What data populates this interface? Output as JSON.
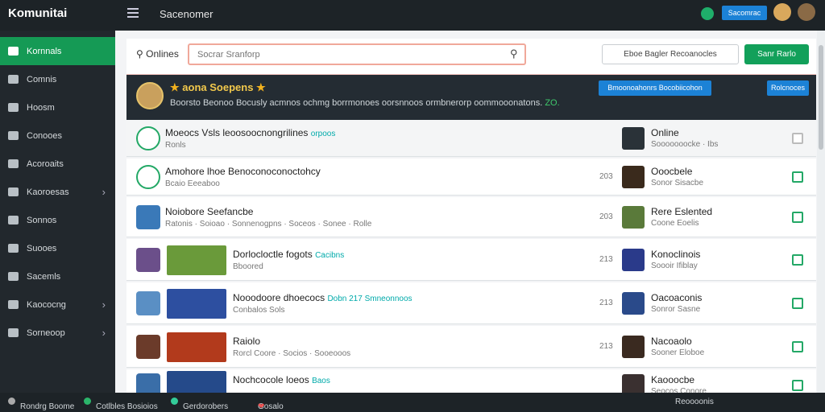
{
  "header": {
    "brand": "Komunitai",
    "title": "Sacenomer",
    "button": "Sacomrac"
  },
  "sidebar": {
    "items": [
      {
        "label": "Kornnals",
        "active": true,
        "chevron": false
      },
      {
        "label": "Comnis",
        "active": false,
        "chevron": false
      },
      {
        "label": "Hoosm",
        "active": false,
        "chevron": false
      },
      {
        "label": "Conooes",
        "active": false,
        "chevron": false
      },
      {
        "label": "Acoroaits",
        "active": false,
        "chevron": false
      },
      {
        "label": "Kaoroesas",
        "active": false,
        "chevron": true
      },
      {
        "label": "Sonnos",
        "active": false,
        "chevron": false
      },
      {
        "label": "Suooes",
        "active": false,
        "chevron": false
      },
      {
        "label": "Sacemls",
        "active": false,
        "chevron": false
      },
      {
        "label": "Kaococng",
        "active": false,
        "chevron": true
      },
      {
        "label": "Sorneoop",
        "active": false,
        "chevron": true
      }
    ]
  },
  "search": {
    "label": "Onlines",
    "placeholder": "Socrar Sranforp",
    "filter": "Eboe Bagler Recoanocles",
    "button": "Sanr Rarlo"
  },
  "banner": {
    "title": "aona Soepens",
    "desc": "Boorsto Beonoo Bocusly acmnos ochmg borrmonoes oorsnnoos ormbnerorp oommooonatons.",
    "desc_tail": "ZO.",
    "button1": "Bmoonoahonrs Bocobiicohon",
    "button2": "Rolcnoces"
  },
  "rows": [
    {
      "title": "Moeocs Vsls leoosoocnongrilines",
      "sub": "Ronls",
      "extra": "orpoos",
      "num": "",
      "name": "Online",
      "meta": "Sooooooocke · Ibs"
    },
    {
      "title": "Amohore lhoe Benoconoconoctohcy",
      "sub": "Bcaio Eeeaboo",
      "extra": "",
      "num": "203",
      "name": "Ooocbele",
      "meta": "Sonor Sisacbe"
    },
    {
      "title": "Noiobore Seefancbe",
      "sub": "Ratonis · Soioao · Sonnenogpns · Soceos · Sonee · Rolle",
      "extra": "",
      "num": "203",
      "name": "Rere Eslented",
      "meta": "Coone Eoelis"
    },
    {
      "title": "Dorlocloctle fogots",
      "sub": "Bboored",
      "extra": "Cacibns",
      "num": "213",
      "name": "Konoclinois",
      "meta": "Soooir Ifiblay"
    },
    {
      "title": "Nooodoore dhoecocs",
      "sub": "Conbalos Sols",
      "extra": "Dobn 217 Smneonnoos",
      "num": "213",
      "name": "Oacoaconis",
      "meta": "Sonror Sasne"
    },
    {
      "title": "Raiolo",
      "sub": "Rorcl Coore · Socios · Sooeooos",
      "extra": "",
      "num": "213",
      "name": "Nacoaolo",
      "meta": "Sooner Eloboe"
    },
    {
      "title": "Nochcocole loeos",
      "sub": "",
      "extra": "Baos",
      "num": "",
      "name": "Kaooocbe",
      "meta": "Seocos Conore"
    }
  ],
  "status": {
    "item1": "Rondrg Boome",
    "item2": "Cotlbles Bosioios",
    "item3": "Gerdorobers",
    "item4": "Gosalo",
    "right1": "Reoooonis"
  },
  "colors": {
    "accent_green": "#159a55",
    "accent_blue": "#1c82d6",
    "star": "#f2b21e"
  }
}
